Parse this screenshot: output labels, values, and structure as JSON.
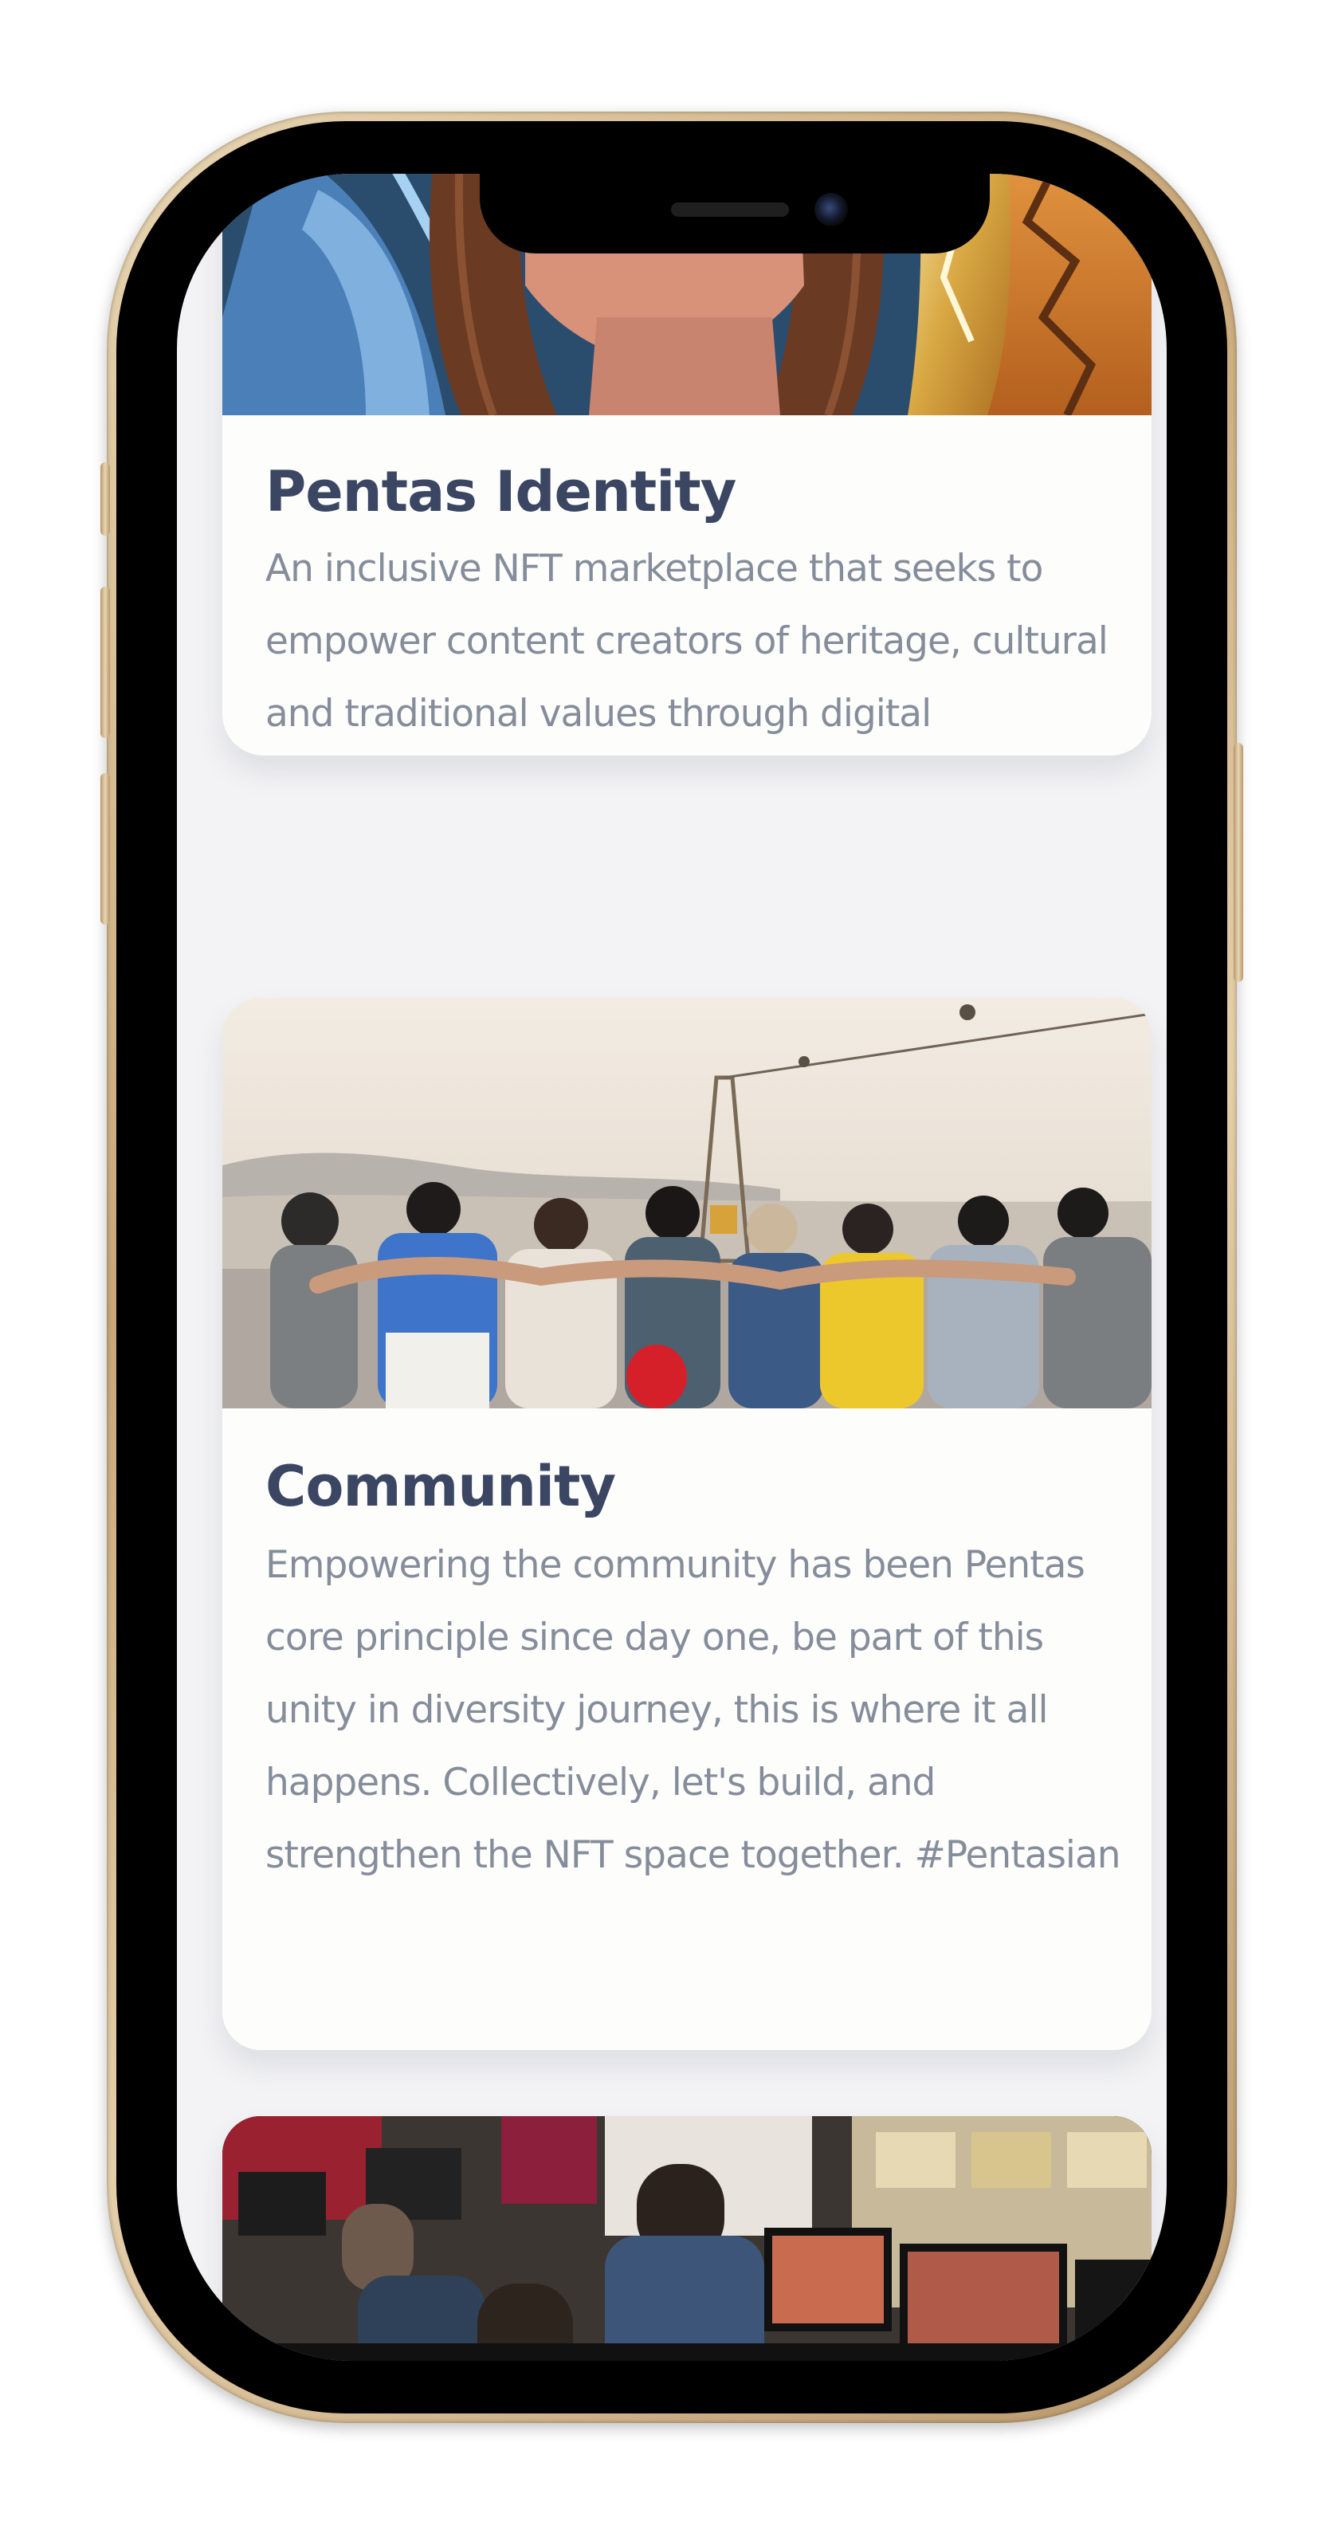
{
  "cards": [
    {
      "title": "Pentas Identity",
      "description": "An inclusive NFT marketplace that seeks to empower content creators of heritage, cultural and traditional values through digital preservation of assets.",
      "image_subject": "digital illustration of a woman with earrings and gold feather art"
    },
    {
      "title": "Community",
      "description": "Empowering the community has been Pentas core principle since day one, be part of this unity in diversity journey, this is where it all happens. Collectively, let's build, and strengthen the NFT space together. #Pentasian",
      "image_subject": "group of friends standing arm in arm facing a hazy hilltop view"
    },
    {
      "title": "",
      "description": "",
      "image_subject": "people working at computer monitors in an office"
    }
  ],
  "colors": {
    "title": "#3b4663",
    "body_text": "#858d9b",
    "card_background": "#fdfdfc",
    "screen_background": "#f3f3f5",
    "phone_frame": "#c8a778"
  }
}
